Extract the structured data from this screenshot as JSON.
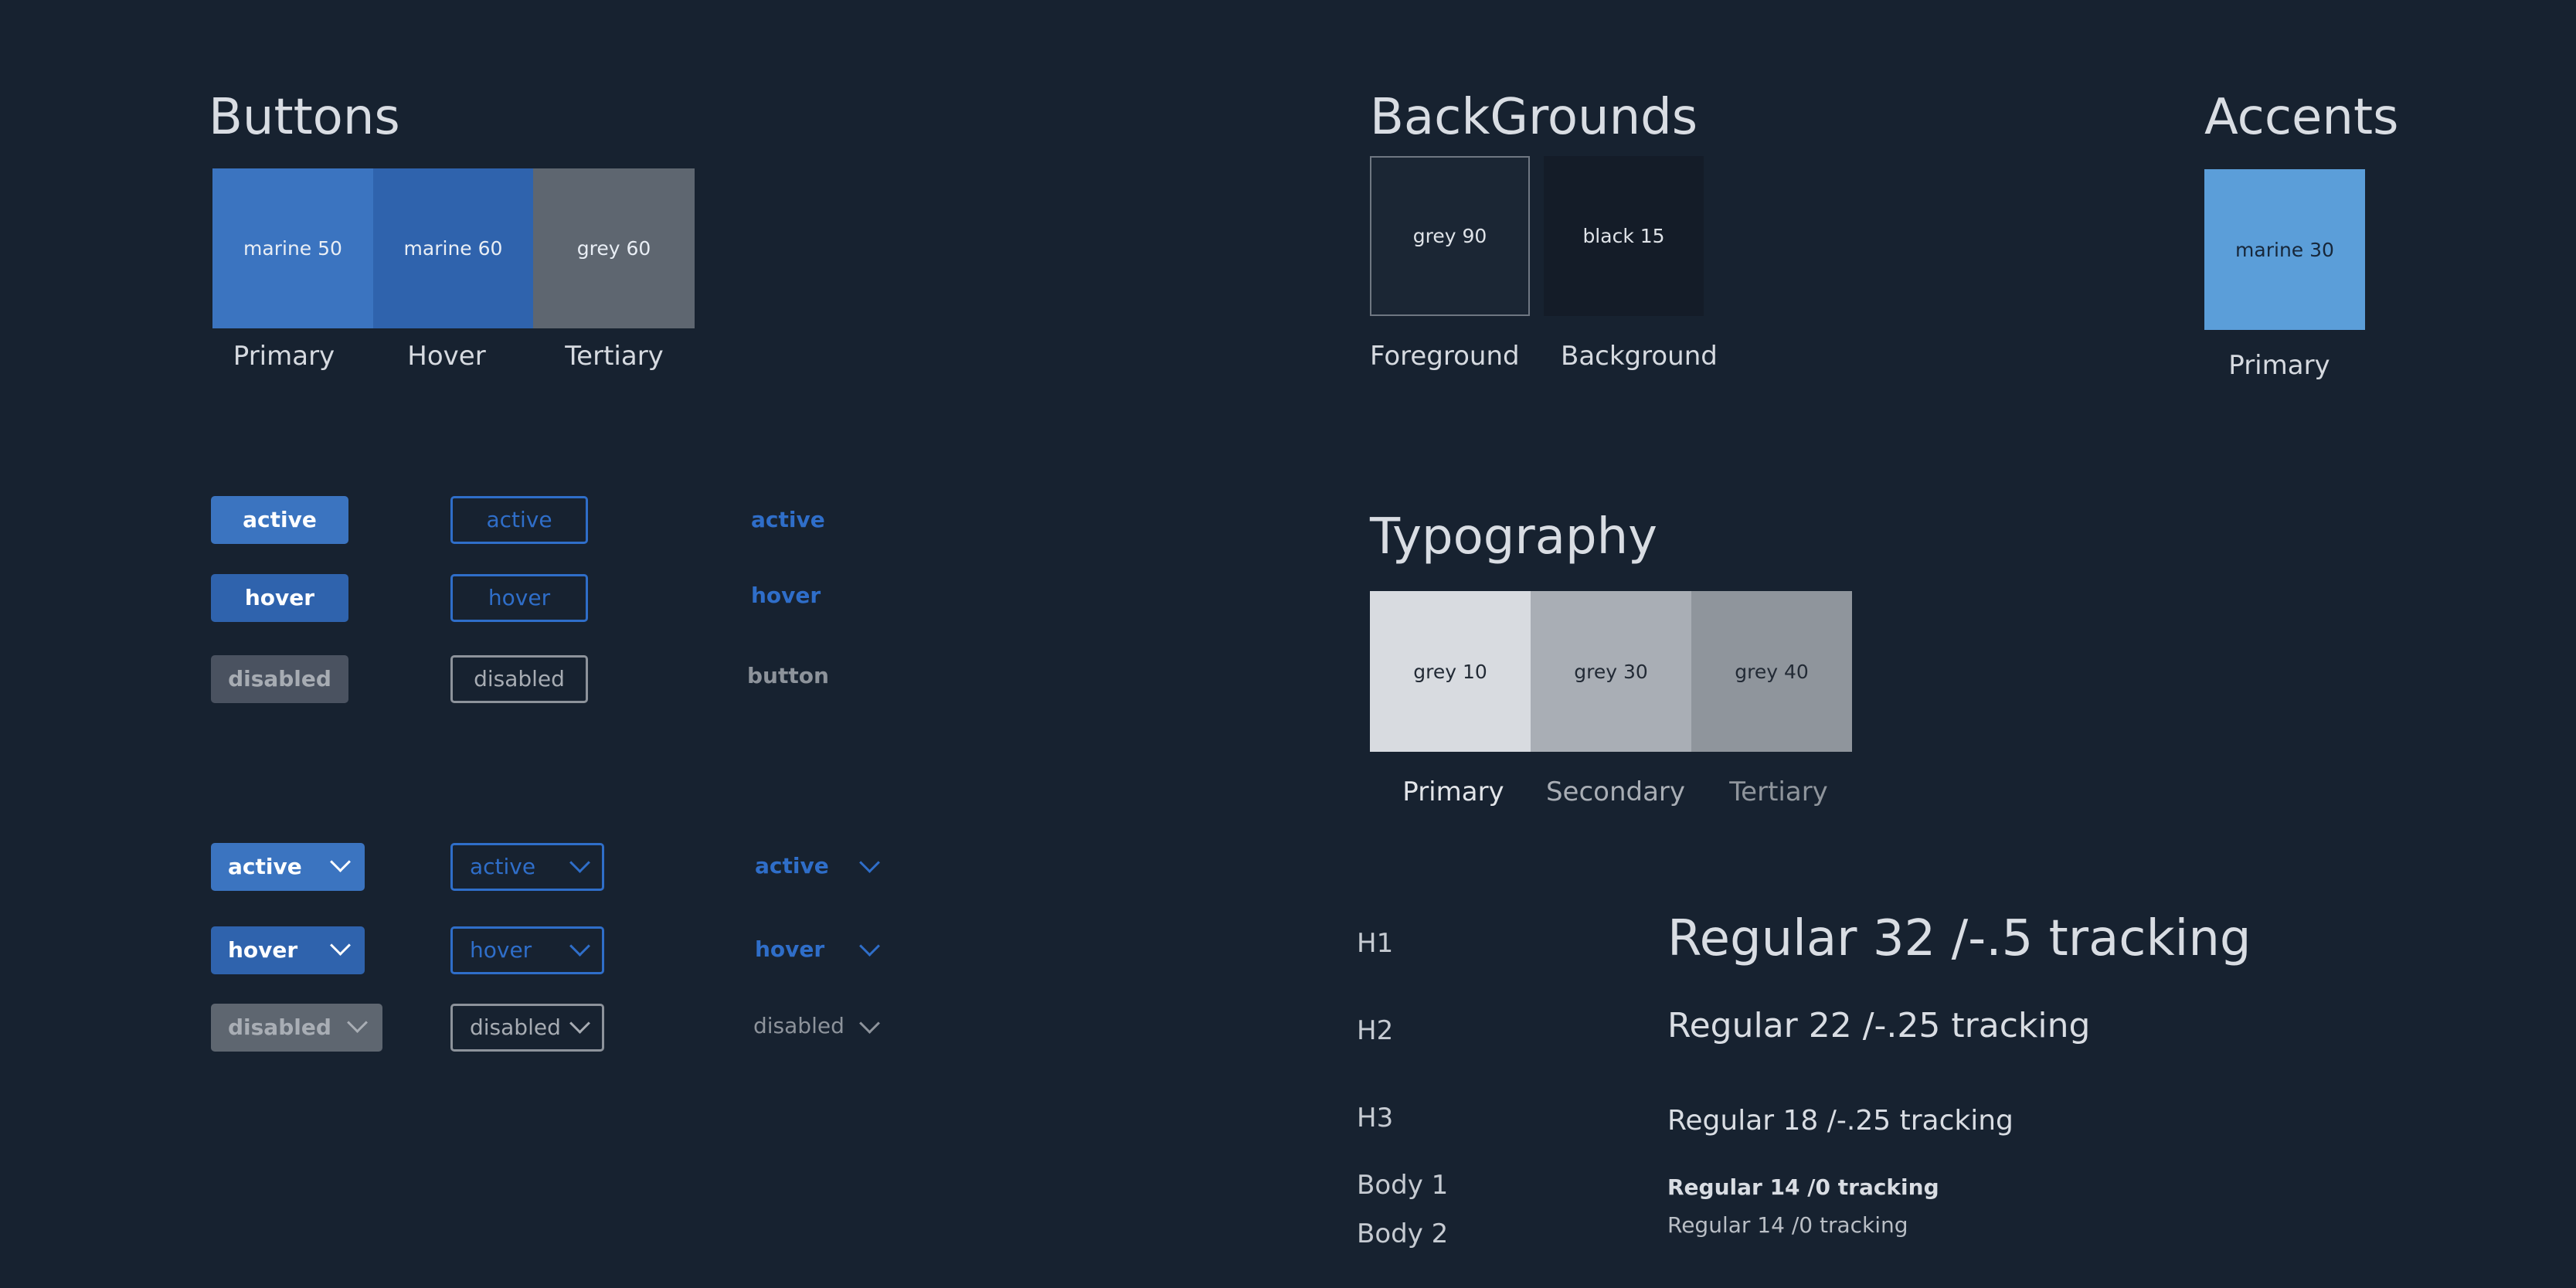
{
  "buttons_section": {
    "title": "Buttons",
    "swatches": [
      {
        "name": "marine 50",
        "color": "#3b74c0",
        "caption": "Primary"
      },
      {
        "name": "marine 60",
        "color": "#2f63ad",
        "caption": "Hover"
      },
      {
        "name": "grey 60",
        "color": "#5e6670",
        "caption": "Tertiary"
      }
    ],
    "simple": {
      "filled": [
        "active",
        "hover",
        "disabled"
      ],
      "outline": [
        "active",
        "hover",
        "disabled"
      ],
      "text": [
        "active",
        "hover",
        "button"
      ]
    },
    "dropdowns": {
      "filled": [
        "active",
        "hover",
        "disabled"
      ],
      "outline": [
        "active",
        "hover",
        "disabled"
      ],
      "text": [
        "active",
        "hover",
        "disabled"
      ]
    }
  },
  "backgrounds_section": {
    "title": "BackGrounds",
    "swatches": [
      {
        "name": "grey 90",
        "color": "#1b2634",
        "caption": "Foreground"
      },
      {
        "name": "black 15",
        "color": "#141c28",
        "caption": "Background"
      }
    ]
  },
  "accents_section": {
    "title": "Accents",
    "swatches": [
      {
        "name": "marine 30",
        "color": "#5b9ed9",
        "caption": "Primary"
      }
    ]
  },
  "typography_section": {
    "title": "Typography",
    "swatches": [
      {
        "name": "grey 10",
        "color": "#d8dbe0",
        "caption": "Primary"
      },
      {
        "name": "grey 30",
        "color": "#a9aeb5",
        "caption": "Secondary"
      },
      {
        "name": "grey 40",
        "color": "#8f959c",
        "caption": "Tertiary"
      }
    ],
    "scale": [
      {
        "label": "H1",
        "sample": "Regular 32 /-.5 tracking"
      },
      {
        "label": "H2",
        "sample": "Regular 22 /-.25 tracking"
      },
      {
        "label": "H3",
        "sample": "Regular 18 /-.25 tracking"
      },
      {
        "label": "Body 1",
        "sample": "Regular 14 /0 tracking"
      },
      {
        "label": "Body 2",
        "sample": "Regular 14 /0 tracking"
      }
    ]
  },
  "colors": {
    "page_bg": "#172230",
    "primary_blue": "#2f6ec9",
    "disabled_grey": "#4a5260"
  }
}
